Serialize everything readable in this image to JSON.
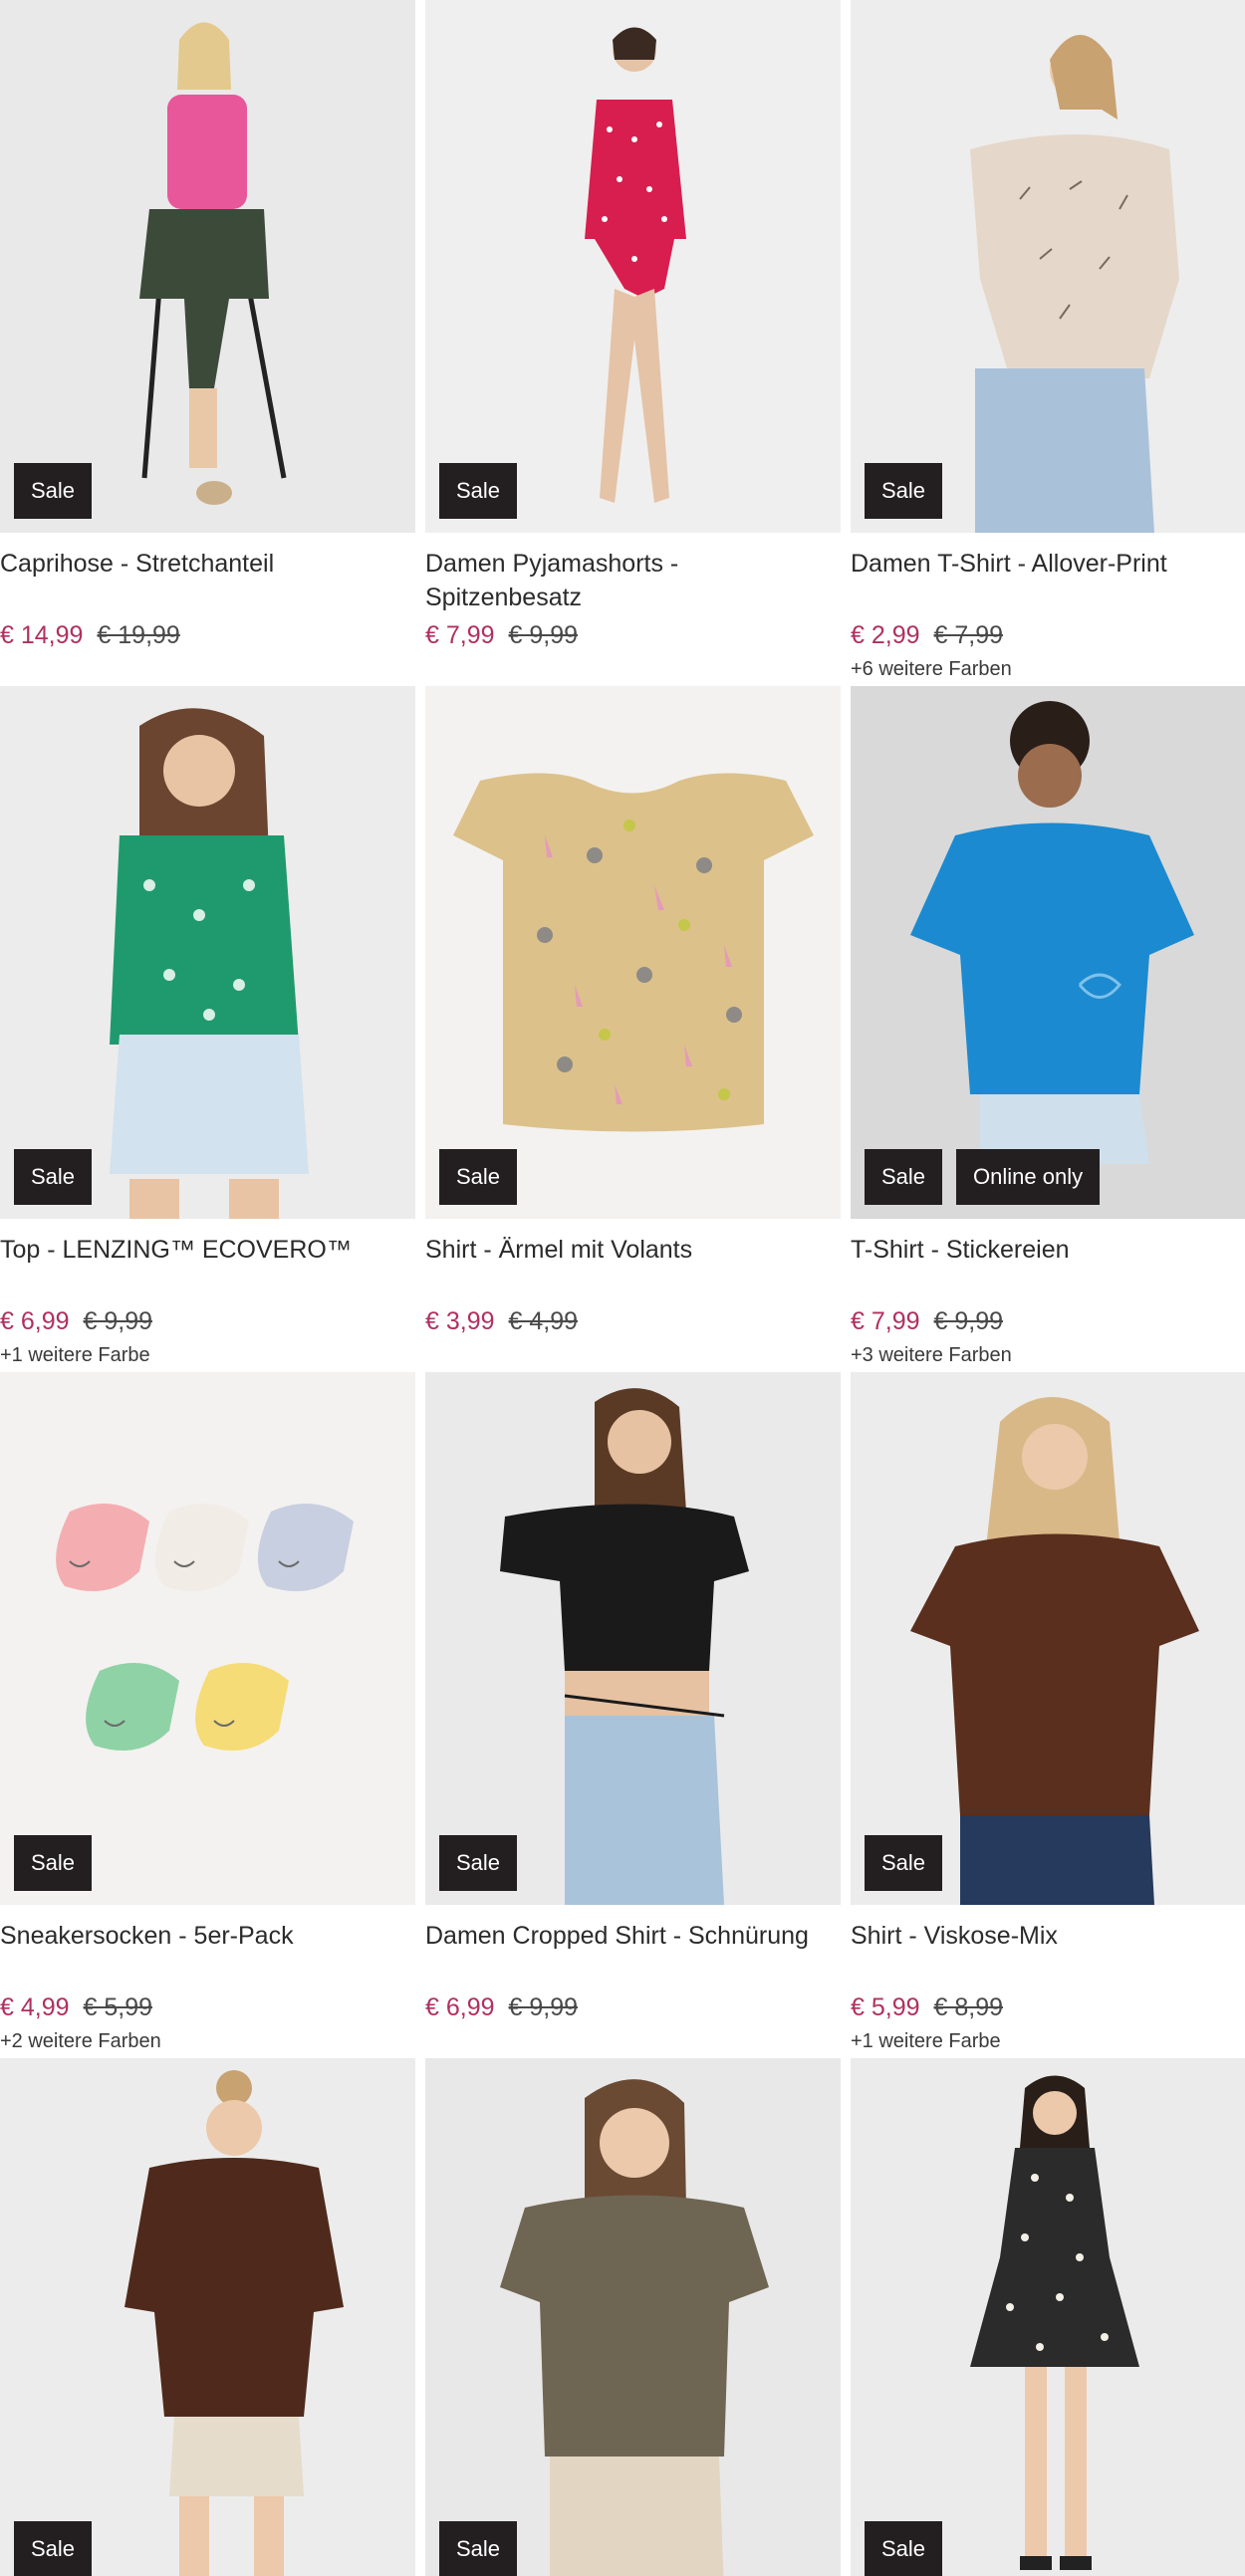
{
  "products": [
    {
      "title": "Caprihose - Stretchanteil",
      "price": "€ 14,99",
      "old_price": "€ 19,99",
      "colors": "",
      "badges": [
        "Sale"
      ],
      "image": "woman-pink-tank-floral-pants"
    },
    {
      "title": "Damen Pyjamashorts - Spitzenbesatz",
      "price": "€ 7,99",
      "old_price": "€ 9,99",
      "colors": "",
      "badges": [
        "Sale"
      ],
      "image": "woman-red-dotted-pyjama"
    },
    {
      "title": "Damen T-Shirt - Allover-Print",
      "price": "€ 2,99",
      "old_price": "€ 7,99",
      "colors": "+6 weitere Farben",
      "badges": [
        "Sale"
      ],
      "image": "woman-beige-print-tshirt"
    },
    {
      "title": "Top - LENZING™ ECOVERO™",
      "price": "€ 6,99",
      "old_price": "€ 9,99",
      "colors": "+1 weitere Farbe",
      "badges": [
        "Sale"
      ],
      "image": "woman-green-top"
    },
    {
      "title": "Shirt - Ärmel mit Volants",
      "price": "€ 3,99",
      "old_price": "€ 4,99",
      "colors": "",
      "badges": [
        "Sale"
      ],
      "image": "beige-giraffe-shirt"
    },
    {
      "title": "T-Shirt - Stickereien",
      "price": "€ 7,99",
      "old_price": "€ 9,99",
      "colors": "+3 weitere Farben",
      "badges": [
        "Sale",
        "Online only"
      ],
      "image": "woman-blue-tshirt"
    },
    {
      "title": "Sneakersocken - 5er-Pack",
      "price": "€ 4,99",
      "old_price": "€ 5,99",
      "colors": "+2 weitere Farben",
      "badges": [
        "Sale"
      ],
      "image": "pastel-smiley-socks"
    },
    {
      "title": "Damen Cropped Shirt - Schnürung",
      "price": "€ 6,99",
      "old_price": "€ 9,99",
      "colors": "",
      "badges": [
        "Sale"
      ],
      "image": "woman-black-cropped-shirt"
    },
    {
      "title": "Shirt - Viskose-Mix",
      "price": "€ 5,99",
      "old_price": "€ 8,99",
      "colors": "+1 weitere Farbe",
      "badges": [
        "Sale"
      ],
      "image": "woman-brown-shirt"
    },
    {
      "title": "",
      "price": "",
      "old_price": "",
      "colors": "",
      "badges": [
        "Sale"
      ],
      "image": "woman-brown-sweater"
    },
    {
      "title": "",
      "price": "",
      "old_price": "",
      "colors": "",
      "badges": [
        "Sale"
      ],
      "image": "woman-olive-tshirt"
    },
    {
      "title": "",
      "price": "",
      "old_price": "",
      "colors": "",
      "badges": [
        "Sale"
      ],
      "image": "woman-floral-dress"
    }
  ],
  "colors": {
    "price_sale": "#b0305f",
    "badge_bg": "#231f20",
    "badge_text": "#ffffff"
  }
}
